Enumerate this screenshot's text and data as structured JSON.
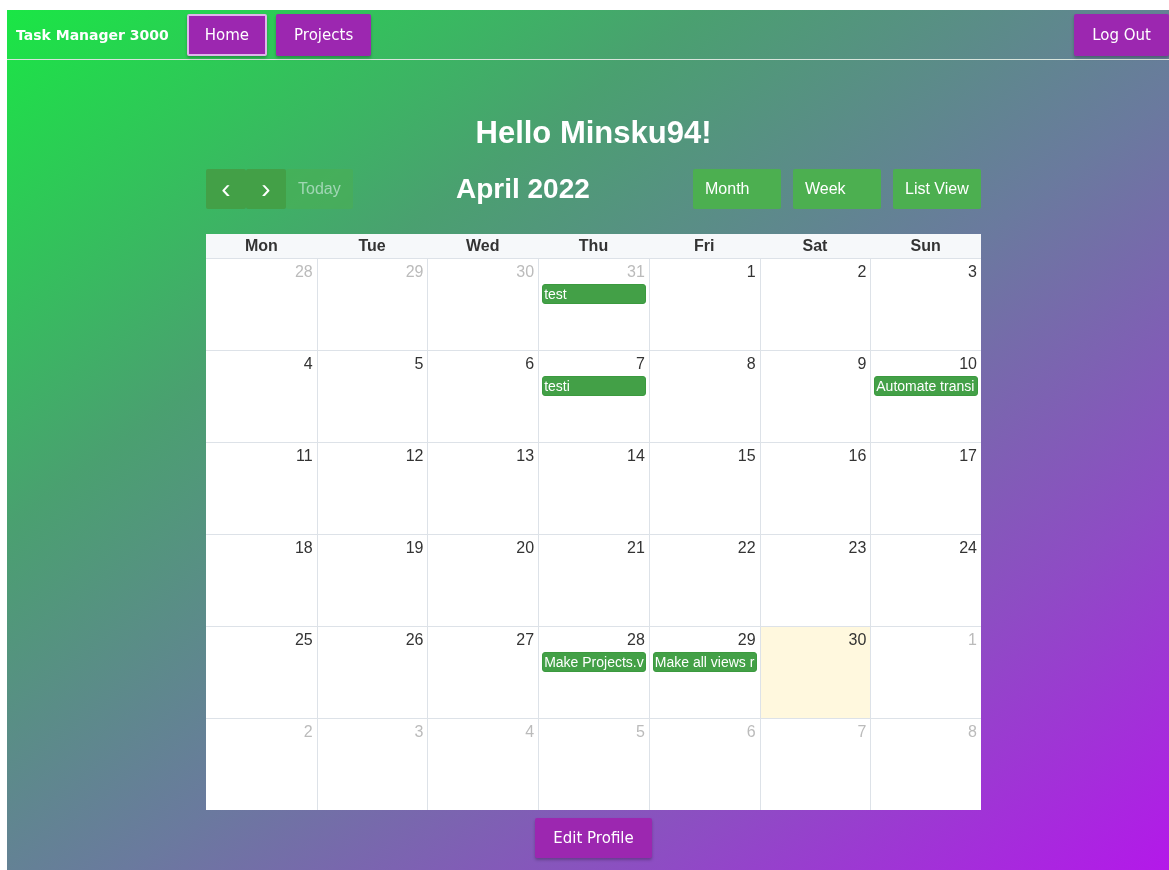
{
  "navbar": {
    "brand": "Task Manager 3000",
    "links": [
      {
        "label": "Home",
        "selected": true
      },
      {
        "label": "Projects",
        "selected": false
      }
    ],
    "logout": "Log Out"
  },
  "greeting": "Hello Minsku94!",
  "calendar": {
    "prev": "‹",
    "next": "›",
    "today_button": {
      "label": "Today",
      "disabled": true
    },
    "title": "April 2022",
    "views": [
      {
        "label": "Month"
      },
      {
        "label": "Week"
      },
      {
        "label": "List View"
      }
    ],
    "weekdays": [
      "Mon",
      "Tue",
      "Wed",
      "Thu",
      "Fri",
      "Sat",
      "Sun"
    ],
    "weeks": [
      [
        {
          "day": "28",
          "other_month": true
        },
        {
          "day": "29",
          "other_month": true
        },
        {
          "day": "30",
          "other_month": true
        },
        {
          "day": "31",
          "other_month": true,
          "events": [
            "test"
          ]
        },
        {
          "day": "1",
          "other_month": false
        },
        {
          "day": "2",
          "other_month": false
        },
        {
          "day": "3",
          "other_month": false
        }
      ],
      [
        {
          "day": "4",
          "other_month": false
        },
        {
          "day": "5",
          "other_month": false
        },
        {
          "day": "6",
          "other_month": false
        },
        {
          "day": "7",
          "other_month": false,
          "events": [
            "testi"
          ]
        },
        {
          "day": "8",
          "other_month": false
        },
        {
          "day": "9",
          "other_month": false
        },
        {
          "day": "10",
          "other_month": false,
          "events": [
            "Automate transi"
          ]
        }
      ],
      [
        {
          "day": "11",
          "other_month": false
        },
        {
          "day": "12",
          "other_month": false
        },
        {
          "day": "13",
          "other_month": false
        },
        {
          "day": "14",
          "other_month": false
        },
        {
          "day": "15",
          "other_month": false
        },
        {
          "day": "16",
          "other_month": false
        },
        {
          "day": "17",
          "other_month": false
        }
      ],
      [
        {
          "day": "18",
          "other_month": false
        },
        {
          "day": "19",
          "other_month": false
        },
        {
          "day": "20",
          "other_month": false
        },
        {
          "day": "21",
          "other_month": false
        },
        {
          "day": "22",
          "other_month": false
        },
        {
          "day": "23",
          "other_month": false
        },
        {
          "day": "24",
          "other_month": false
        }
      ],
      [
        {
          "day": "25",
          "other_month": false
        },
        {
          "day": "26",
          "other_month": false
        },
        {
          "day": "27",
          "other_month": false
        },
        {
          "day": "28",
          "other_month": false,
          "events": [
            "Make Projects.v"
          ]
        },
        {
          "day": "29",
          "other_month": false,
          "events": [
            "Make all views r"
          ]
        },
        {
          "day": "30",
          "other_month": false,
          "today": true
        },
        {
          "day": "1",
          "other_month": true
        }
      ],
      [
        {
          "day": "2",
          "other_month": true
        },
        {
          "day": "3",
          "other_month": true
        },
        {
          "day": "4",
          "other_month": true
        },
        {
          "day": "5",
          "other_month": true
        },
        {
          "day": "6",
          "other_month": true
        },
        {
          "day": "7",
          "other_month": true
        },
        {
          "day": "8",
          "other_month": true
        }
      ]
    ]
  },
  "edit_profile": "Edit Profile"
}
